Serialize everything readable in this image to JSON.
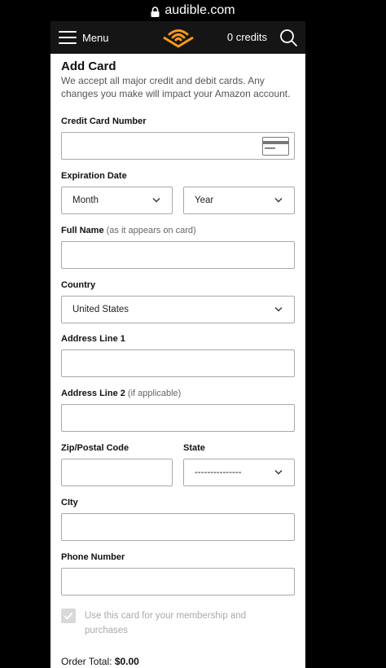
{
  "browser": {
    "url": "audible.com"
  },
  "header": {
    "menu_label": "Menu",
    "credits": "0 credits"
  },
  "form": {
    "title": "Add Card",
    "intro": "We accept all major credit and debit cards. Any changes you make will impact your Amazon account.",
    "card_number": {
      "label": "Credit Card Number",
      "value": ""
    },
    "expiration": {
      "label": "Expiration Date",
      "month": "Month",
      "year": "Year"
    },
    "full_name": {
      "label": "Full Name",
      "hint": "(as it appears on card)",
      "value": ""
    },
    "country": {
      "label": "Country",
      "value": "United States"
    },
    "address1": {
      "label": "Address Line 1",
      "value": ""
    },
    "address2": {
      "label": "Address Line 2",
      "hint": "(if applicable)",
      "value": ""
    },
    "zip": {
      "label": "Zip/Postal Code",
      "value": ""
    },
    "state": {
      "label": "State",
      "value": "---------------"
    },
    "city": {
      "label": "CIty",
      "value": ""
    },
    "phone": {
      "label": "Phone Number",
      "value": ""
    },
    "membership_checkbox": {
      "label": "Use this card for your membership and purchases",
      "checked": true,
      "disabled": true
    },
    "order_total": {
      "label": "Order Total:",
      "value": "$0.00"
    }
  },
  "colors": {
    "brand_orange": "#f7991c",
    "header_bg": "#151515",
    "border": "#a9a9a9"
  }
}
